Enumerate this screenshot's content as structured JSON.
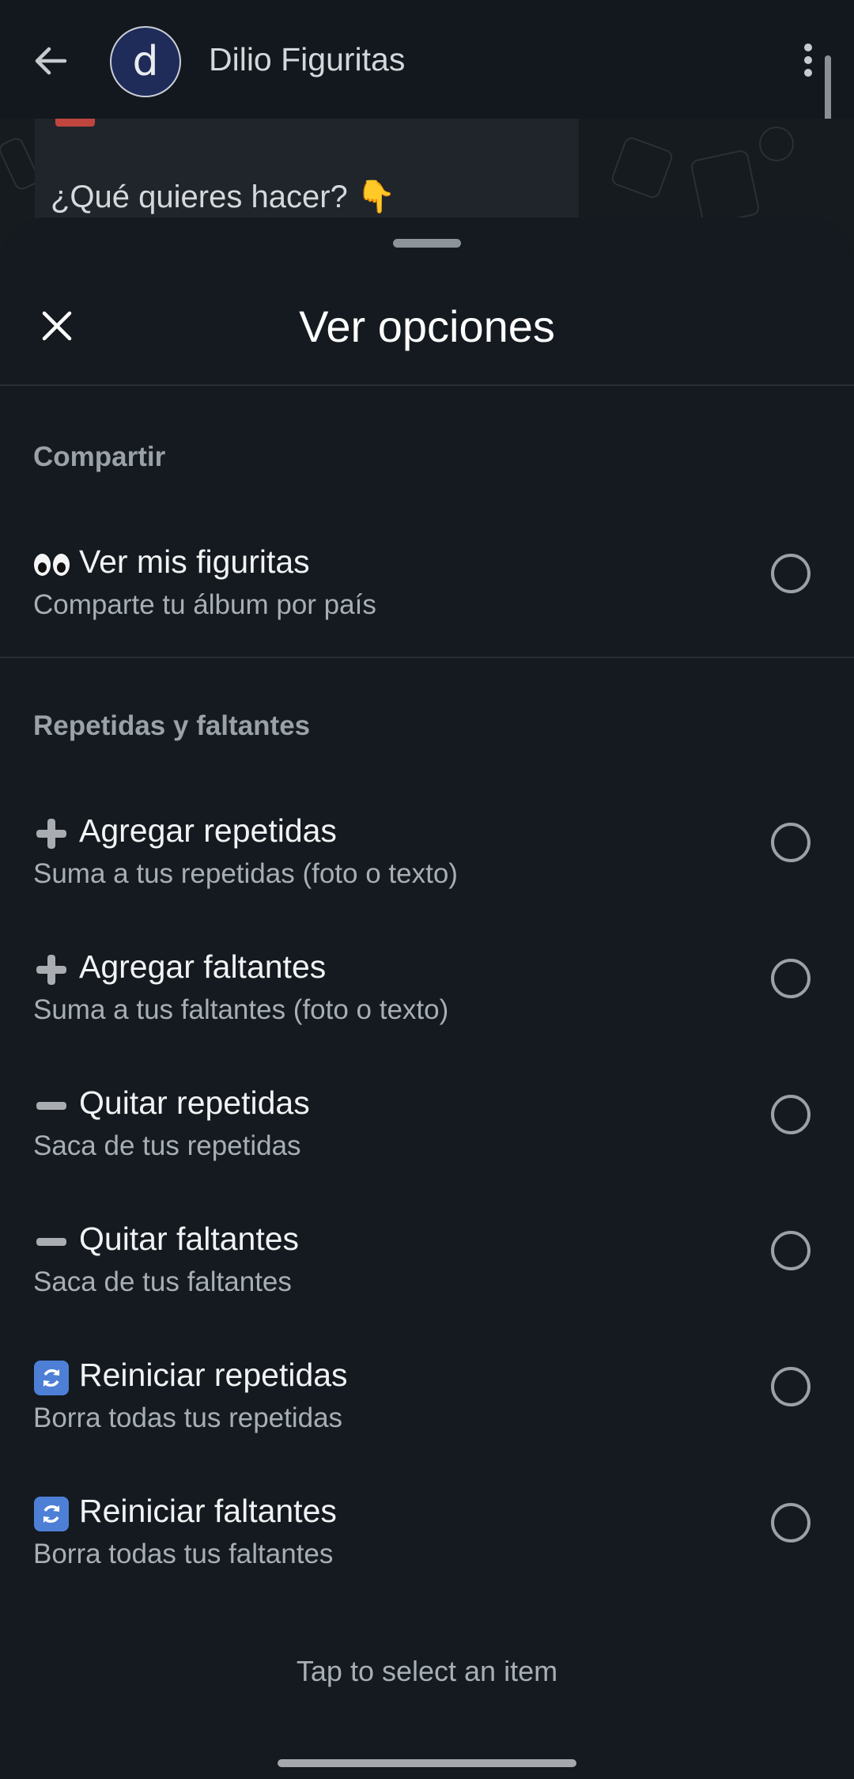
{
  "header": {
    "contact_name": "Dilio Figuritas",
    "avatar_letter": "d",
    "icons": {
      "back": "arrow-left-icon",
      "menu": "more-vertical-icon"
    }
  },
  "chat": {
    "last_message": "¿Qué quieres hacer? 👇"
  },
  "sheet": {
    "title": "Ver opciones",
    "close_icon": "close-icon",
    "sections": [
      {
        "heading": "Compartir",
        "options": [
          {
            "emoji": "eyes",
            "title": "Ver mis figuritas",
            "subtitle": "Comparte tu álbum por país",
            "selected": false
          }
        ]
      },
      {
        "heading": "Repetidas y faltantes",
        "options": [
          {
            "emoji": "plus",
            "title": "Agregar repetidas",
            "subtitle": "Suma a tus repetidas (foto o texto)",
            "selected": false
          },
          {
            "emoji": "plus",
            "title": "Agregar faltantes",
            "subtitle": "Suma a tus faltantes (foto o texto)",
            "selected": false
          },
          {
            "emoji": "minus",
            "title": "Quitar repetidas",
            "subtitle": "Saca de tus repetidas",
            "selected": false
          },
          {
            "emoji": "minus",
            "title": "Quitar faltantes",
            "subtitle": "Saca de tus faltantes",
            "selected": false
          },
          {
            "emoji": "refresh",
            "title": "Reiniciar repetidas",
            "subtitle": "Borra todas tus repetidas",
            "selected": false
          },
          {
            "emoji": "refresh",
            "title": "Reiniciar faltantes",
            "subtitle": "Borra todas tus faltantes",
            "selected": false
          }
        ]
      }
    ],
    "hint": "Tap to select an item"
  },
  "colors": {
    "sheet_bg": "#141a1f",
    "header_bg": "#12181d",
    "avatar_bg": "#1f2c5a",
    "radio_border": "#9aa1a7"
  }
}
